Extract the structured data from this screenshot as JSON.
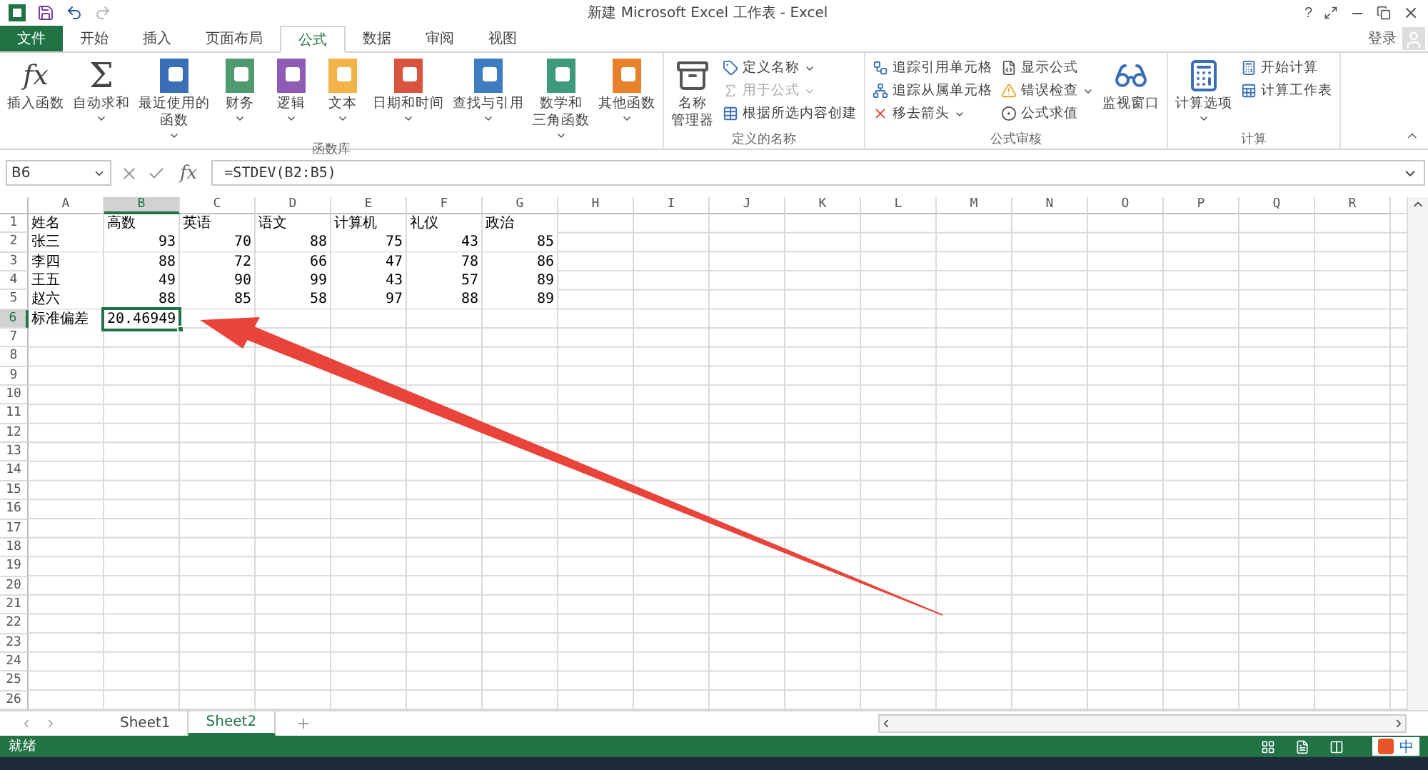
{
  "window": {
    "title": "新建 Microsoft Excel 工作表 - Excel",
    "help": "?",
    "login": "登录"
  },
  "tabs": [
    {
      "label": "文件",
      "kind": "file",
      "selected": false
    },
    {
      "label": "开始",
      "kind": "tab",
      "selected": false
    },
    {
      "label": "插入",
      "kind": "tab",
      "selected": false
    },
    {
      "label": "页面布局",
      "kind": "tab",
      "selected": false
    },
    {
      "label": "公式",
      "kind": "tab",
      "selected": true
    },
    {
      "label": "数据",
      "kind": "tab",
      "selected": false
    },
    {
      "label": "审阅",
      "kind": "tab",
      "selected": false
    },
    {
      "label": "视图",
      "kind": "tab",
      "selected": false
    }
  ],
  "ribbon": [
    {
      "label": "函数库",
      "large": [
        {
          "kind": "glyph",
          "glyph": "fx",
          "lines": [
            "插入函数"
          ],
          "dropdown": false
        },
        {
          "kind": "glyph",
          "glyph": "Σ",
          "lines": [
            "自动求和"
          ],
          "dropdown": true
        },
        {
          "kind": "book",
          "color": "#3a6fb5",
          "lines": [
            "最近使用的",
            "函数"
          ],
          "dropdown": true
        },
        {
          "kind": "book",
          "color": "#4f9a6e",
          "lines": [
            "财务"
          ],
          "dropdown": true
        },
        {
          "kind": "book",
          "color": "#8e5bb5",
          "lines": [
            "逻辑"
          ],
          "dropdown": true
        },
        {
          "kind": "book",
          "color": "#f0b44a",
          "lines": [
            "文本"
          ],
          "dropdown": true
        },
        {
          "kind": "book",
          "color": "#d9543f",
          "lines": [
            "日期和时间"
          ],
          "dropdown": true
        },
        {
          "kind": "book",
          "color": "#3e7ec0",
          "lines": [
            "查找与引用"
          ],
          "dropdown": true
        },
        {
          "kind": "book",
          "color": "#3f9a7a",
          "lines": [
            "数学和",
            "三角函数"
          ],
          "dropdown": true
        },
        {
          "kind": "book",
          "color": "#e8812b",
          "lines": [
            "其他函数"
          ],
          "dropdown": true
        }
      ]
    },
    {
      "label": "定义的名称",
      "large": [
        {
          "kind": "names",
          "lines": [
            "名称",
            "管理器"
          ],
          "dropdown": false
        }
      ],
      "small": [
        {
          "label": "定义名称",
          "dropdown": true,
          "disabled": false
        },
        {
          "label": "用于公式",
          "dropdown": true,
          "disabled": true
        },
        {
          "label": "根据所选内容创建",
          "dropdown": false,
          "disabled": false
        }
      ]
    },
    {
      "label": "公式审核",
      "small": [
        {
          "label": "追踪引用单元格",
          "dropdown": false,
          "disabled": false
        },
        {
          "label": "追踪从属单元格",
          "dropdown": false,
          "disabled": false
        },
        {
          "label": "移去箭头",
          "dropdown": true,
          "disabled": false
        },
        {
          "label": "显示公式",
          "dropdown": false,
          "disabled": false
        },
        {
          "label": "错误检查",
          "dropdown": true,
          "disabled": false
        },
        {
          "label": "公式求值",
          "dropdown": false,
          "disabled": false
        }
      ],
      "large_after": [
        {
          "kind": "watch",
          "lines": [
            "监视窗口"
          ],
          "dropdown": false
        }
      ]
    },
    {
      "label": "计算",
      "large": [
        {
          "kind": "calc",
          "lines": [
            "计算选项"
          ],
          "dropdown": true
        }
      ],
      "small": [
        {
          "label": "开始计算",
          "dropdown": false,
          "disabled": false
        },
        {
          "label": "计算工作表",
          "dropdown": false,
          "disabled": false
        }
      ]
    }
  ],
  "formula_bar": {
    "name_box": "B6",
    "fx": "fx",
    "formula": "=STDEV(B2:B5)"
  },
  "columns": [
    {
      "letter": "A",
      "selected": false
    },
    {
      "letter": "B",
      "selected": true
    },
    {
      "letter": "C",
      "selected": false
    },
    {
      "letter": "D",
      "selected": false
    },
    {
      "letter": "E",
      "selected": false
    },
    {
      "letter": "F",
      "selected": false
    },
    {
      "letter": "G",
      "selected": false
    },
    {
      "letter": "H",
      "selected": false
    },
    {
      "letter": "I",
      "selected": false
    },
    {
      "letter": "J",
      "selected": false
    },
    {
      "letter": "K",
      "selected": false
    },
    {
      "letter": "L",
      "selected": false
    },
    {
      "letter": "M",
      "selected": false
    },
    {
      "letter": "N",
      "selected": false
    },
    {
      "letter": "O",
      "selected": false
    },
    {
      "letter": "P",
      "selected": false
    },
    {
      "letter": "Q",
      "selected": false
    },
    {
      "letter": "R",
      "selected": false
    }
  ],
  "rows": [
    {
      "number": "1",
      "kind": "header",
      "selected": false,
      "cells": [
        "姓名",
        "高数",
        "英语",
        "语文",
        "计算机",
        "礼仪",
        "政治"
      ]
    },
    {
      "number": "2",
      "kind": "data",
      "selected": false,
      "cells": [
        "张三",
        "93",
        "70",
        "88",
        "75",
        "43",
        "85"
      ]
    },
    {
      "number": "3",
      "kind": "data",
      "selected": false,
      "cells": [
        "李四",
        "88",
        "72",
        "66",
        "47",
        "78",
        "86"
      ]
    },
    {
      "number": "4",
      "kind": "data",
      "selected": false,
      "cells": [
        "王五",
        "49",
        "90",
        "99",
        "43",
        "57",
        "89"
      ]
    },
    {
      "number": "5",
      "kind": "data",
      "selected": false,
      "cells": [
        "赵六",
        "88",
        "85",
        "58",
        "97",
        "88",
        "89"
      ]
    },
    {
      "number": "6",
      "kind": "data",
      "selected": true,
      "cells": [
        "标准偏差",
        "20.46949"
      ]
    },
    {
      "number": "7",
      "selected": false
    },
    {
      "number": "8",
      "selected": false
    },
    {
      "number": "9",
      "selected": false
    },
    {
      "number": "10",
      "selected": false
    },
    {
      "number": "11",
      "selected": false
    },
    {
      "number": "12",
      "selected": false
    },
    {
      "number": "13",
      "selected": false
    },
    {
      "number": "14",
      "selected": false
    },
    {
      "number": "15",
      "selected": false
    },
    {
      "number": "16",
      "selected": false
    },
    {
      "number": "17",
      "selected": false
    },
    {
      "number": "18",
      "selected": false
    },
    {
      "number": "19",
      "selected": false
    },
    {
      "number": "20",
      "selected": false
    },
    {
      "number": "21",
      "selected": false
    },
    {
      "number": "22",
      "selected": false
    },
    {
      "number": "23",
      "selected": false
    },
    {
      "number": "24",
      "selected": false
    },
    {
      "number": "25",
      "selected": false
    },
    {
      "number": "26",
      "selected": false
    }
  ],
  "sheets": [
    {
      "label": "Sheet1",
      "selected": false
    },
    {
      "label": "Sheet2",
      "selected": true
    }
  ],
  "status_bar": {
    "text": "就绪",
    "ime": "中"
  }
}
